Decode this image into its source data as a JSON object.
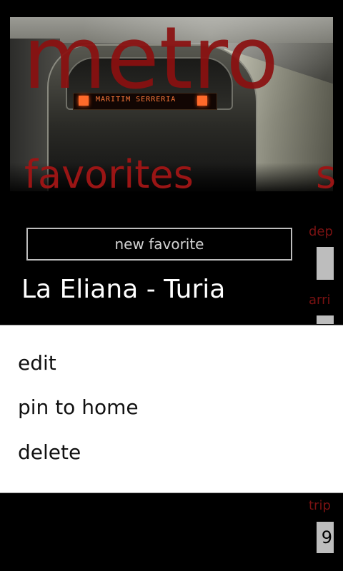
{
  "app": {
    "title": "metro"
  },
  "background": {
    "destination_sign": "MARITIM  SERRERIA"
  },
  "panorama": {
    "current_section": "favorites",
    "next_section_peek": "s"
  },
  "favorites": {
    "new_favorite_label": "new favorite",
    "items": [
      {
        "label": "La Eliana - Turia"
      }
    ]
  },
  "search_peek": {
    "departure_label": "dep",
    "arrival_label": "arri",
    "trip_label": "trip",
    "trip_value": "9"
  },
  "context_menu": {
    "items": [
      {
        "label": "edit"
      },
      {
        "label": "pin to home"
      },
      {
        "label": "delete"
      }
    ]
  },
  "colors": {
    "accent": "#9a1515",
    "background": "#000000",
    "menu_background": "#ffffff"
  }
}
